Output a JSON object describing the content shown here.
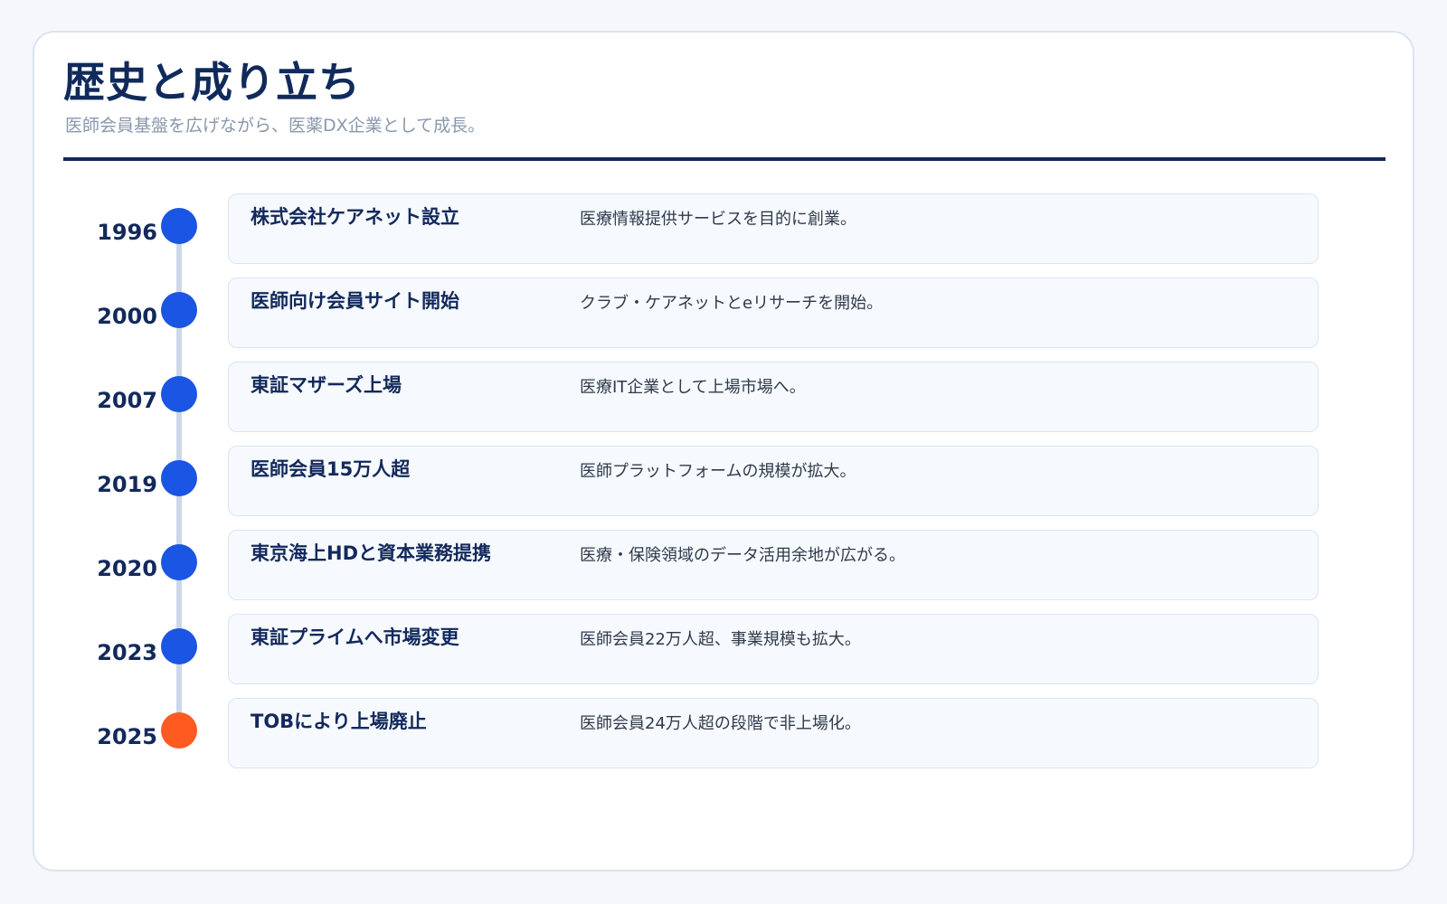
{
  "header": {
    "title": "歴史と成り立ち",
    "subtitle": "医師会員基盤を広げながら、医薬DX企業として成長。"
  },
  "colors": {
    "milestone": "#1a55e3",
    "milestone_latest": "#ff5a1f",
    "heading": "#13295b"
  },
  "timeline": [
    {
      "year": "1996",
      "title": "株式会社ケアネット設立",
      "description": "医療情報提供サービスを目的に創業。",
      "marker": "milestone"
    },
    {
      "year": "2000",
      "title": "医師向け会員サイト開始",
      "description": "クラブ・ケアネットとeリサーチを開始。",
      "marker": "milestone"
    },
    {
      "year": "2007",
      "title": "東証マザーズ上場",
      "description": "医療IT企業として上場市場へ。",
      "marker": "milestone"
    },
    {
      "year": "2019",
      "title": "医師会員15万人超",
      "description": "医師プラットフォームの規模が拡大。",
      "marker": "milestone"
    },
    {
      "year": "2020",
      "title": "東京海上HDと資本業務提携",
      "description": "医療・保険領域のデータ活用余地が広がる。",
      "marker": "milestone"
    },
    {
      "year": "2023",
      "title": "東証プライムへ市場変更",
      "description": "医師会員22万人超、事業規模も拡大。",
      "marker": "milestone"
    },
    {
      "year": "2025",
      "title": "TOBにより上場廃止",
      "description": "医師会員24万人超の段階で非上場化。",
      "marker": "milestone_latest"
    }
  ]
}
